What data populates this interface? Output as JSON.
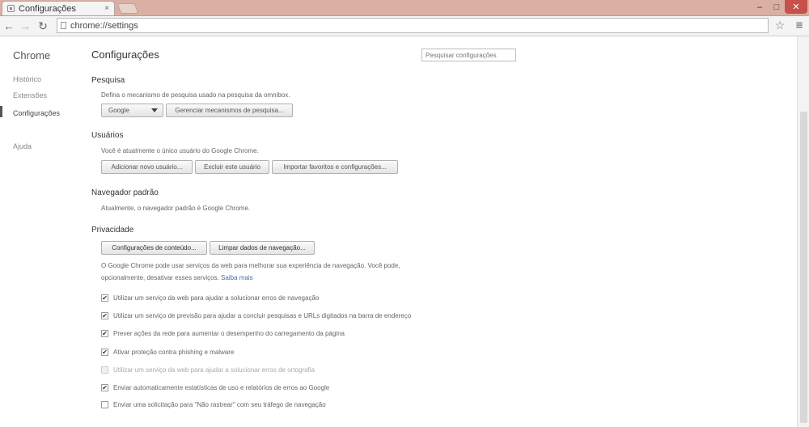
{
  "window": {
    "tab_title": "Configurações",
    "tab_close": "×",
    "minimize": "–",
    "maximize": "□",
    "close": "✕"
  },
  "toolbar": {
    "back": "←",
    "forward": "→",
    "reload": "↻",
    "url": "chrome://settings",
    "star": "☆",
    "menu": "≡"
  },
  "sidebar": {
    "title": "Chrome",
    "items": [
      {
        "label": "Histórico",
        "active": false
      },
      {
        "label": "Extensões",
        "active": false
      },
      {
        "label": "Configurações",
        "active": true
      },
      {
        "label": "Ajuda",
        "active": false
      }
    ]
  },
  "main": {
    "title": "Configurações",
    "search_placeholder": "Pesquisar configurações",
    "search": {
      "title": "Pesquisa",
      "description": "Defina o mecanismo de pesquisa usado na pesquisa da omnibox.",
      "engine_selected": "Google",
      "manage_button": "Gerenciar mecanismos de pesquisa..."
    },
    "users": {
      "title": "Usuários",
      "description": "Você é atualmente o único usuário do Google Chrome.",
      "add_button": "Adicionar novo usuário...",
      "delete_button": "Excluir este usuário",
      "import_button": "Importar favoritos e configurações..."
    },
    "default_browser": {
      "title": "Navegador padrão",
      "description": "Atualmente, o navegador padrão é Google Chrome."
    },
    "privacy": {
      "title": "Privacidade",
      "content_settings_button": "Configurações de conteúdo...",
      "clear_data_button": "Limpar dados de navegação...",
      "description_line1": "O Google Chrome pode usar serviços da web para melhorar sua experiência de navegação. Você pode,",
      "description_line2": "opcionalmente, desativar esses serviços.",
      "learn_more": "Saiba mais",
      "options": [
        {
          "label": "Utilizar um serviço da web para ajudar a solucionar erros de navegação",
          "checked": true,
          "disabled": false
        },
        {
          "label": "Utilizar um serviço de previsão para ajudar a concluir pesquisas e URLs digitados na barra de endereço",
          "checked": true,
          "disabled": false
        },
        {
          "label": "Prever ações da rede para aumentar o desempenho do carregamento da página",
          "checked": true,
          "disabled": false
        },
        {
          "label": "Ativar proteção contra phishing e malware",
          "checked": true,
          "disabled": false
        },
        {
          "label": "Utilizar um serviço da web para ajudar a solucionar erros de ortografia",
          "checked": false,
          "disabled": true
        },
        {
          "label": "Enviar automaticamente estatísticas de uso e relatórios de erros ao Google",
          "checked": true,
          "disabled": false
        },
        {
          "label": "Enviar uma solicitação para \"Não rastrear\" com seu tráfego de navegação",
          "checked": false,
          "disabled": false
        }
      ]
    }
  }
}
